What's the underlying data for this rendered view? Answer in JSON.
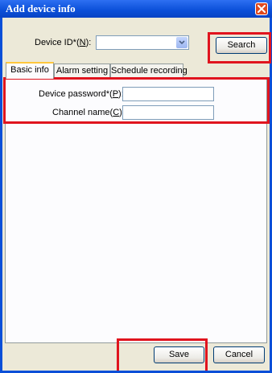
{
  "window": {
    "title": "Add device info"
  },
  "device_id": {
    "label": "Device ID*(",
    "hotkey": "N",
    "suffix": "):",
    "value": ""
  },
  "search_button": {
    "label": "Search"
  },
  "tabs": [
    {
      "label": "Basic info",
      "active": true
    },
    {
      "label": "Alarm setting",
      "active": false
    },
    {
      "label": "Schedule recording",
      "active": false
    }
  ],
  "basic_info": {
    "password": {
      "label": "Device password*(",
      "hotkey": "P",
      "suffix": "):",
      "value": ""
    },
    "channel": {
      "label": "Channel name(",
      "hotkey": "C",
      "suffix": "):",
      "value": ""
    }
  },
  "footer": {
    "save_label": "Save",
    "cancel_label": "Cancel"
  },
  "colors": {
    "highlight": "#e0141e",
    "titlebar": "#0a4fd8",
    "dialog_bg": "#ece9d8"
  },
  "icons": {
    "close": "close-icon",
    "dropdown": "chevron-down-icon"
  }
}
